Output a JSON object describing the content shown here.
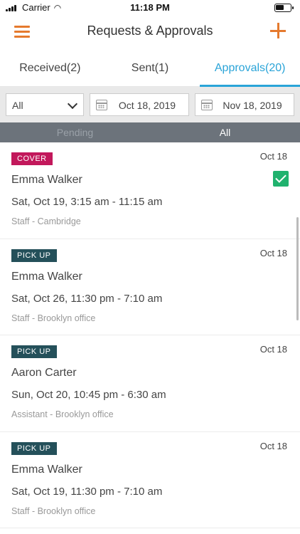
{
  "status_bar": {
    "carrier": "Carrier",
    "time": "11:18 PM"
  },
  "nav": {
    "title": "Requests & Approvals",
    "menu_icon": "hamburger-icon",
    "add_icon": "plus-icon",
    "accent": "#e57a2e"
  },
  "tabs": [
    {
      "label": "Received(2)",
      "active": false
    },
    {
      "label": "Sent(1)",
      "active": false
    },
    {
      "label": "Approvals(20)",
      "active": true
    }
  ],
  "filters": {
    "select_value": "All",
    "start_date": "Oct 18, 2019",
    "end_date": "Nov 18, 2019"
  },
  "segment": {
    "pending_label": "Pending",
    "all_label": "All"
  },
  "requests": [
    {
      "type": "COVER",
      "date": "Oct 18",
      "name": "Emma Walker",
      "time": "Sat, Oct 19, 3:15 am - 11:15 am",
      "location": "Staff - Cambridge",
      "checked": true
    },
    {
      "type": "PICK UP",
      "date": "Oct 18",
      "name": "Emma Walker",
      "time": "Sat, Oct 26, 11:30 pm - 7:10 am",
      "location": "Staff - Brooklyn office",
      "checked": false
    },
    {
      "type": "PICK UP",
      "date": "Oct 18",
      "name": "Aaron Carter",
      "time": "Sun, Oct 20, 10:45 pm - 6:30 am",
      "location": "Assistant - Brooklyn office",
      "checked": false
    },
    {
      "type": "PICK UP",
      "date": "Oct 18",
      "name": "Emma Walker",
      "time": "Sat, Oct 19, 11:30 pm - 7:10 am",
      "location": "Staff - Brooklyn office",
      "checked": false
    }
  ],
  "colors": {
    "active_tab": "#2aa4d8",
    "cover_badge": "#c2185b",
    "pickup_badge": "#24505a",
    "check": "#20b26e"
  }
}
